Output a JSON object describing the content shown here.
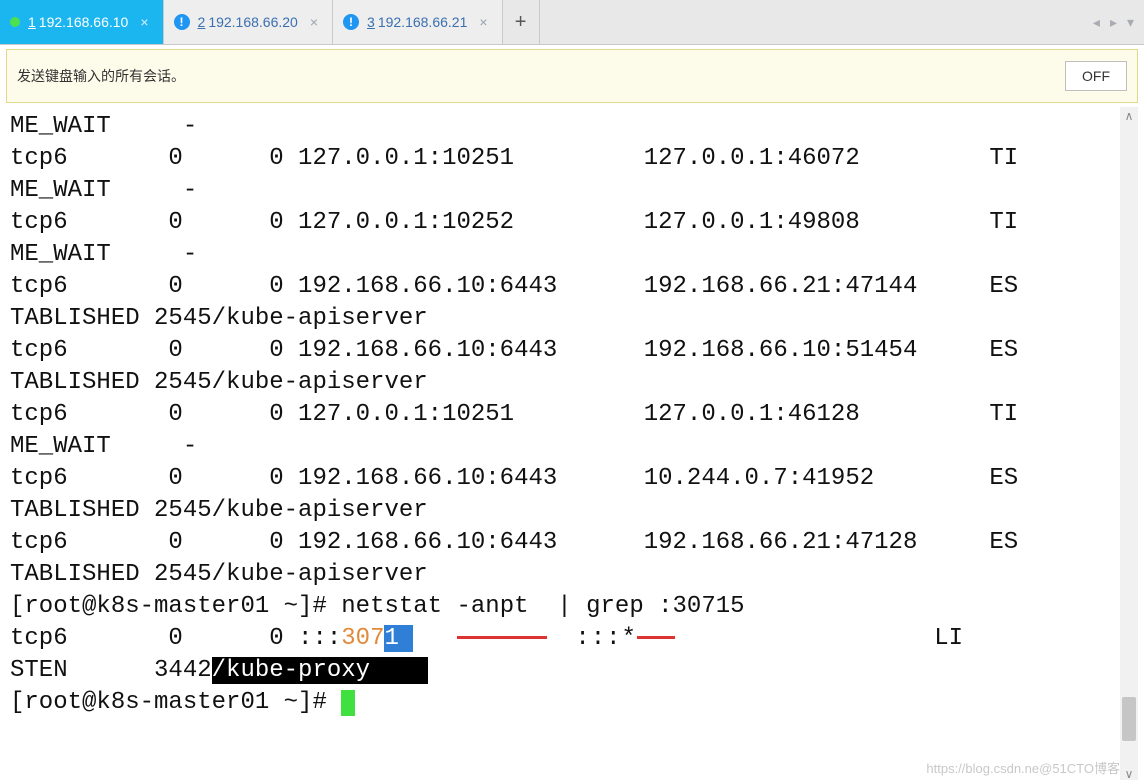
{
  "tabs": [
    {
      "index": "1",
      "label": "192.168.66.10",
      "active": true
    },
    {
      "index": "2",
      "label": "192.168.66.20",
      "active": false
    },
    {
      "index": "3",
      "label": "192.168.66.21",
      "active": false
    }
  ],
  "sendbar": {
    "message": "发送键盘输入的所有会话。",
    "off": "OFF"
  },
  "terminal": {
    "lines": [
      "ME_WAIT     -",
      "tcp6       0      0 127.0.0.1:10251         127.0.0.1:46072         TI",
      "ME_WAIT     -",
      "tcp6       0      0 127.0.0.1:10252         127.0.0.1:49808         TI",
      "ME_WAIT     -",
      "tcp6       0      0 192.168.66.10:6443      192.168.66.21:47144     ES",
      "TABLISHED 2545/kube-apiserver",
      "tcp6       0      0 192.168.66.10:6443      192.168.66.10:51454     ES",
      "TABLISHED 2545/kube-apiserver",
      "tcp6       0      0 127.0.0.1:10251         127.0.0.1:46128         TI",
      "ME_WAIT     -",
      "tcp6       0      0 192.168.66.10:6443      10.244.0.7:41952        ES",
      "TABLISHED 2545/kube-apiserver",
      "tcp6       0      0 192.168.66.10:6443      192.168.66.21:47128     ES",
      "TABLISHED 2545/kube-apiserver"
    ],
    "cmdline_prompt": "[root@k8s-master01 ~]# ",
    "cmdline_cmd": "netstat -anpt  | grep :30715",
    "result_prefix": "tcp6       0      0 :::",
    "result_port": "307",
    "result_star": ":::*",
    "result_state": "LI",
    "listen_line_a": "STEN      3442",
    "listen_line_b": "/kube-proxy",
    "prompt2": "[root@k8s-master01 ~]# "
  },
  "watermark": "https://blog.csdn.ne@51CTO博客"
}
